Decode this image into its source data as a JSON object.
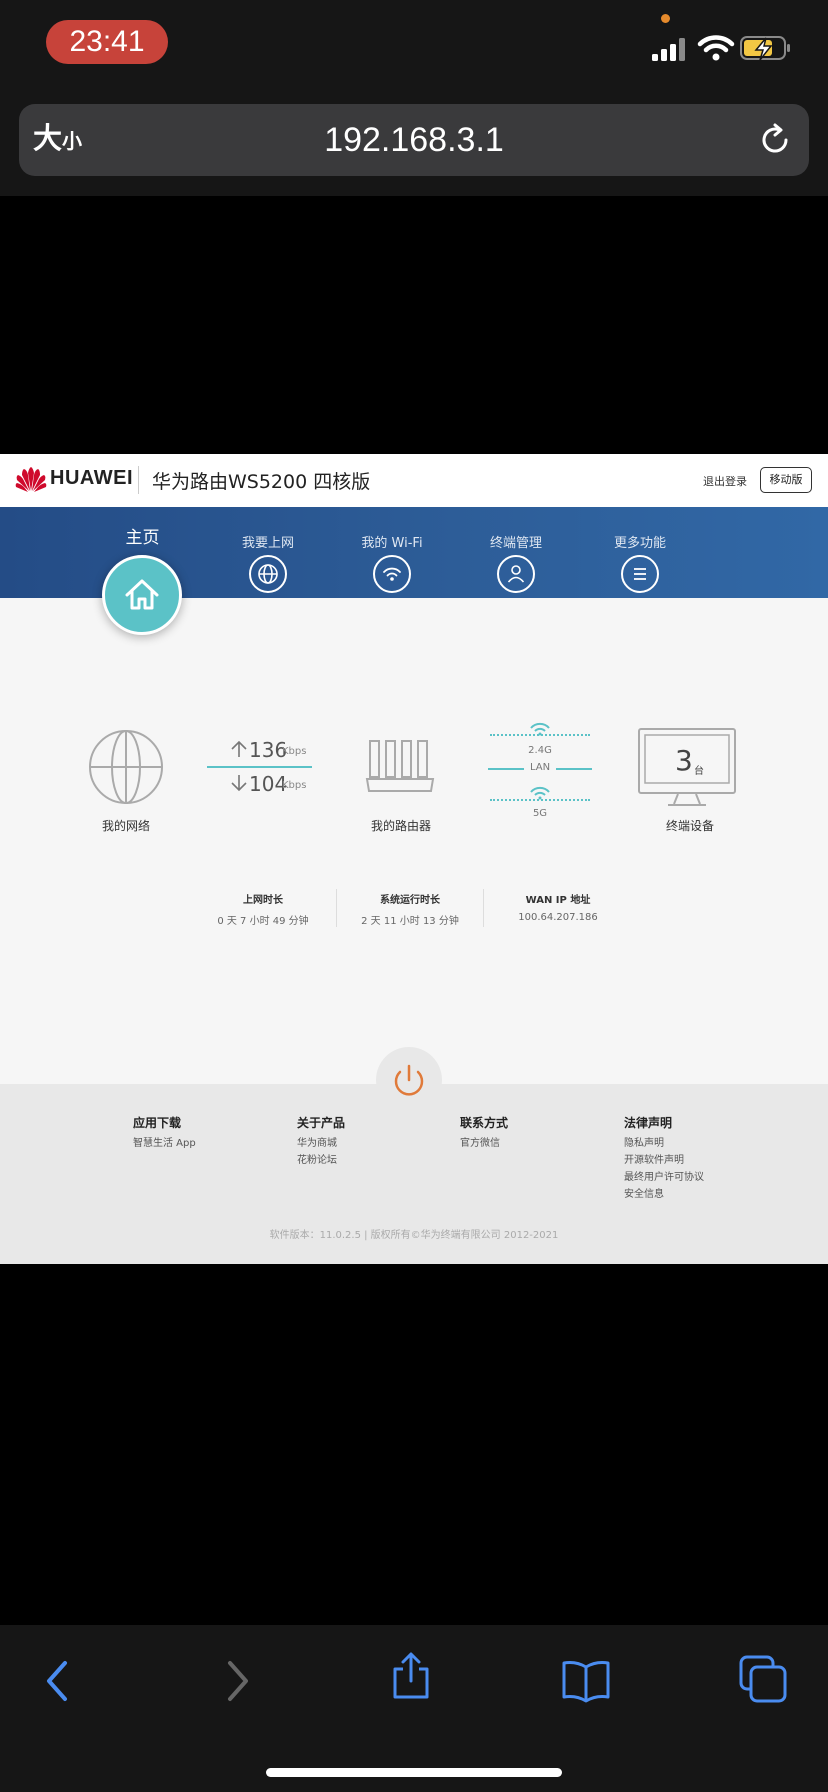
{
  "status_bar": {
    "time": "23:41"
  },
  "browser": {
    "text_size_big": "大",
    "text_size_small": "小",
    "url": "192.168.3.1"
  },
  "header": {
    "brand": "HUAWEI",
    "product_title": "华为路由WS5200 四核版",
    "logout": "退出登录",
    "mobile_version": "移动版"
  },
  "nav": {
    "home": "主页",
    "items": [
      {
        "label": "我要上网",
        "icon": "globe-icon"
      },
      {
        "label": "我的 Wi-Fi",
        "icon": "wifi-icon"
      },
      {
        "label": "终端管理",
        "icon": "person-icon"
      },
      {
        "label": "更多功能",
        "icon": "menu-icon"
      }
    ]
  },
  "dashboard": {
    "my_network": "我的网络",
    "upload_value": "136",
    "download_value": "104",
    "speed_unit": "Kbps",
    "my_router": "我的路由器",
    "band_24": "2.4G",
    "lan": "LAN",
    "band_5": "5G",
    "device_count": "3",
    "device_unit": "台",
    "devices_label": "终端设备"
  },
  "stats": [
    {
      "label": "上网时长",
      "value": "0 天 7 小时 49 分钟"
    },
    {
      "label": "系统运行时长",
      "value": "2 天 11 小时 13 分钟"
    },
    {
      "label": "WAN IP 地址",
      "value": "100.64.207.186"
    }
  ],
  "footer": {
    "columns": [
      {
        "title": "应用下载",
        "items": [
          "智慧生活 App"
        ]
      },
      {
        "title": "关于产品",
        "items": [
          "华为商城",
          "花粉论坛"
        ]
      },
      {
        "title": "联系方式",
        "items": [
          "官方微信"
        ]
      },
      {
        "title": "法律声明",
        "items": [
          "隐私声明",
          "开源软件声明",
          "最终用户许可协议",
          "安全信息"
        ]
      }
    ],
    "copyright": "软件版本：11.0.2.5 |  版权所有©华为终端有限公司 2012-2021"
  },
  "colors": {
    "accent_teal": "#5bc2c7",
    "nav_blue": "#2d5d98",
    "power_orange": "#e07a3a",
    "huawei_red": "#cf0a2c"
  }
}
